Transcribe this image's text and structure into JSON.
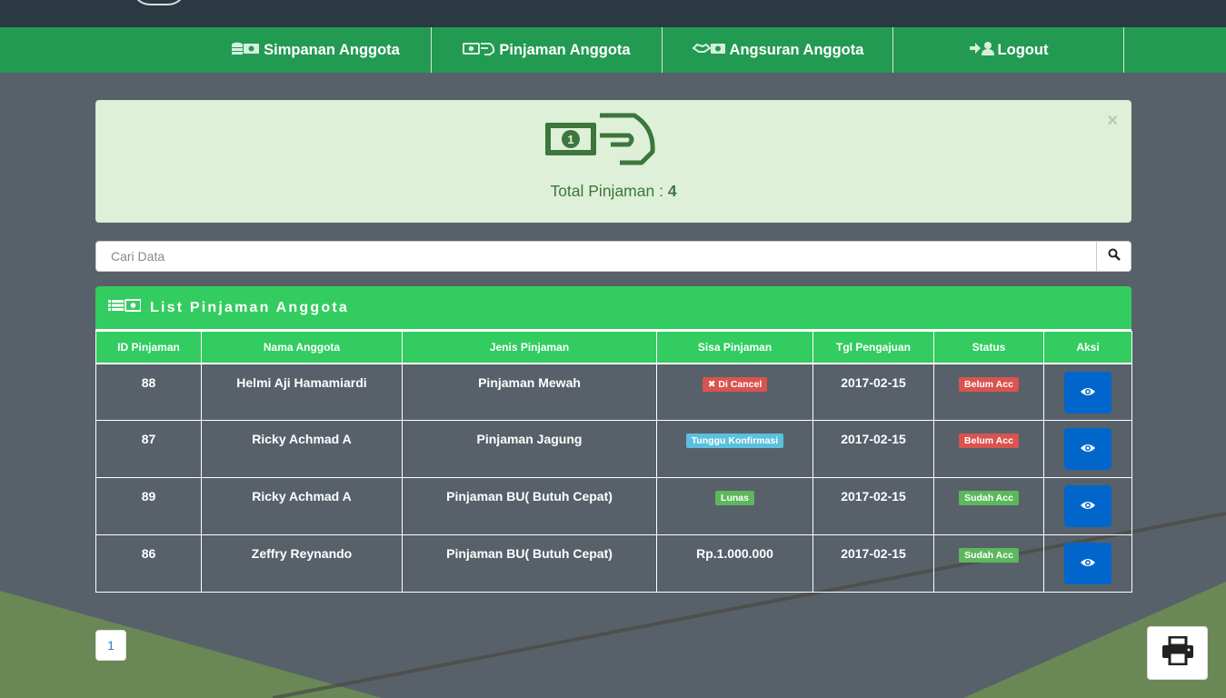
{
  "nav": {
    "items": [
      {
        "label": "Simpanan Anggota",
        "icon": "coins-money-icon"
      },
      {
        "label": "Pinjaman Anggota",
        "icon": "money-hand-icon"
      },
      {
        "label": "Angsuran Anggota",
        "icon": "handshake-money-icon"
      },
      {
        "label": "Logout",
        "icon": "logout-user-icon"
      }
    ]
  },
  "alert": {
    "total_label": "Total Pinjaman : ",
    "total_value": "4",
    "close": "×",
    "icon": "money-hand-icon"
  },
  "search": {
    "placeholder": "Cari Data",
    "icon": "search-icon"
  },
  "panel": {
    "title": "List Pinjaman Anggota",
    "icon": "list-money-icon"
  },
  "table": {
    "headers": [
      "ID Pinjaman",
      "Nama Anggota",
      "Jenis Pinjaman",
      "Sisa Pinjaman",
      "Tgl Pengajuan",
      "Status",
      "Aksi"
    ],
    "rows": [
      {
        "id": "88",
        "nama": "Helmi Aji Hamamiardi",
        "jenis": "Pinjaman Mewah",
        "sisa": "✖ Di Cancel",
        "tgl": "2017-02-15",
        "status": "Belum Acc"
      },
      {
        "id": "87",
        "nama": "Ricky Achmad A",
        "jenis": "Pinjaman Jagung",
        "sisa": "Tunggu Konfirmasi",
        "tgl": "2017-02-15",
        "status": "Belum Acc"
      },
      {
        "id": "89",
        "nama": "Ricky Achmad A",
        "jenis": "Pinjaman BU( Butuh Cepat)",
        "sisa": "Lunas",
        "tgl": "2017-02-15",
        "status": "Sudah Acc"
      },
      {
        "id": "86",
        "nama": "Zeffry Reynando",
        "jenis": "Pinjaman BU( Butuh Cepat)",
        "sisa": "Rp.1.000.000",
        "tgl": "2017-02-15",
        "status": "Sudah Acc"
      }
    ]
  },
  "pagination": {
    "current": "1"
  },
  "colors": {
    "nav_bg": "#239a52",
    "panel_green": "#33cc60",
    "badge_red": "#d9534f",
    "badge_blue": "#5bc0de",
    "badge_green": "#5cb85c",
    "view_button": "#0066cc"
  }
}
